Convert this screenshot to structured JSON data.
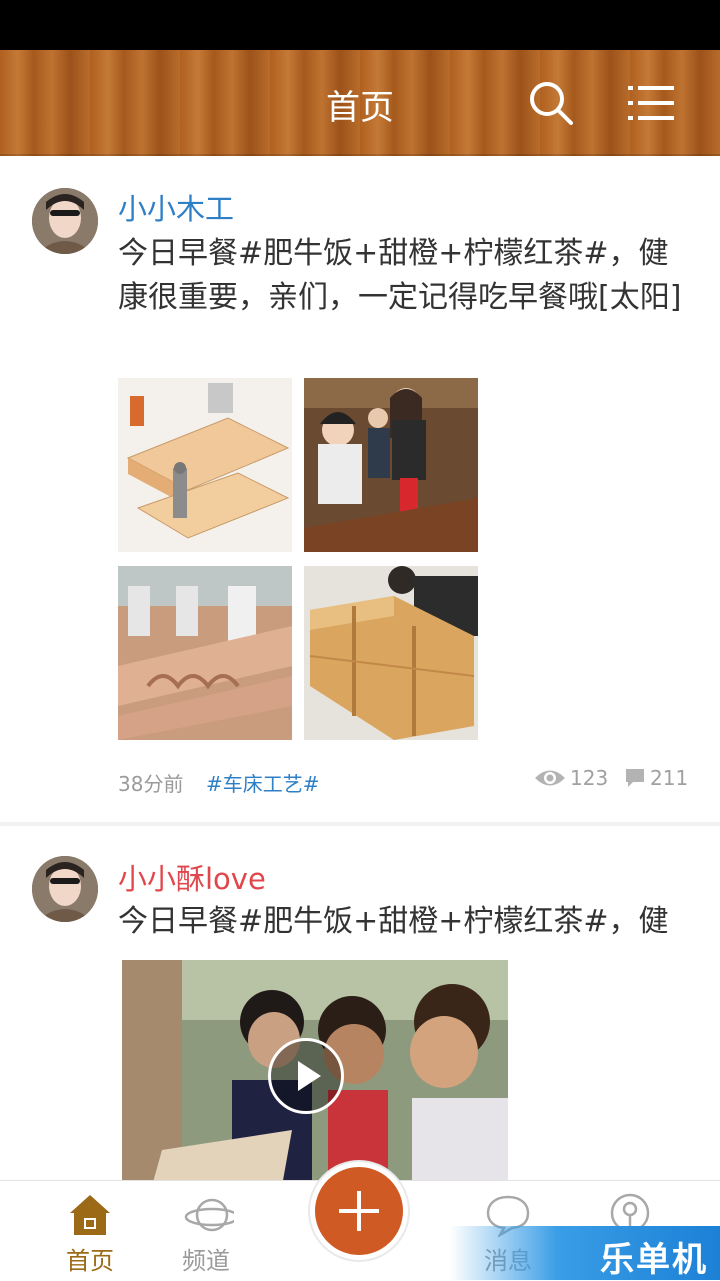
{
  "header": {
    "title": "首页",
    "search_icon": "search-icon",
    "menu_icon": "menu-icon"
  },
  "posts": [
    {
      "username": "小小木工",
      "username_color": "#2f7fc6",
      "content": "今日早餐#肥牛饭+甜橙+柠檬红茶#，健康很重要，亲们，一定记得吃早餐哦[太阳]",
      "time": "38分前",
      "tag": "#车床工艺#",
      "views": "123",
      "comments": "211",
      "images": [
        "woodworking-clamp-illustration",
        "people-at-workbench-photo",
        "cnc-carving-machine-photo",
        "wooden-shelf-photo"
      ]
    },
    {
      "username": "小小酥love",
      "username_color": "#e0474c",
      "content": "今日早餐#肥牛饭+甜橙+柠檬红茶#，健",
      "video": "children-woodworking-video"
    }
  ],
  "tabbar": {
    "items": [
      {
        "label": "首页",
        "icon": "home-icon",
        "active": true
      },
      {
        "label": "频道",
        "icon": "planet-icon",
        "active": false
      },
      {
        "label": "消息",
        "icon": "chat-bubble-icon",
        "active": false
      },
      {
        "label": "",
        "icon": "profile-icon",
        "active": false
      }
    ],
    "add_icon": "plus-icon",
    "active_color": "#9c6a16",
    "inactive_color": "#9a9a9a"
  },
  "watermark": {
    "text": "乐单机"
  }
}
